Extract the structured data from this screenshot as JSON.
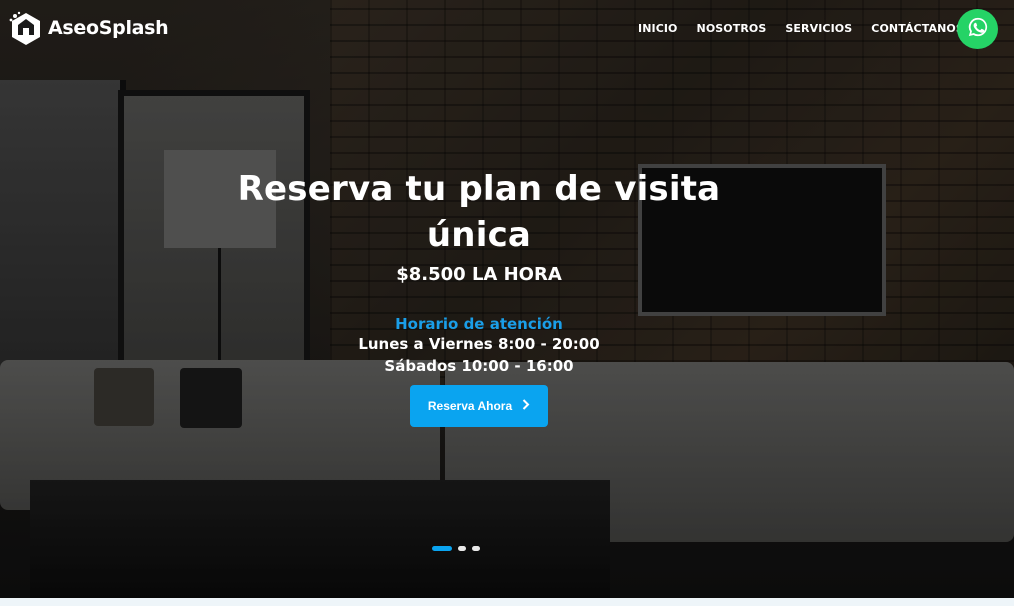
{
  "brand": {
    "name": "AseoSplash"
  },
  "nav": {
    "items": [
      {
        "label": "INICIO"
      },
      {
        "label": "NOSOTROS"
      },
      {
        "label": "SERVICIOS"
      },
      {
        "label": "CONTÁCTANOS"
      }
    ],
    "whatsapp_icon": "whatsapp-icon"
  },
  "hero": {
    "title": "Reserva tu plan de visita única",
    "price": "$8.500 LA HORA",
    "hours_title": "Horario de atención",
    "hours": [
      "Lunes a Viernes 8:00 - 20:00",
      "Sábados 10:00 - 16:00"
    ],
    "cta_label": "Reserva Ahora",
    "cta_icon": "chevron-right-icon",
    "slides_total": 3,
    "active_slide": 1
  },
  "colors": {
    "accent": "#0aa4f0",
    "whatsapp": "#25d366",
    "hours_title": "#1a9ee8"
  }
}
